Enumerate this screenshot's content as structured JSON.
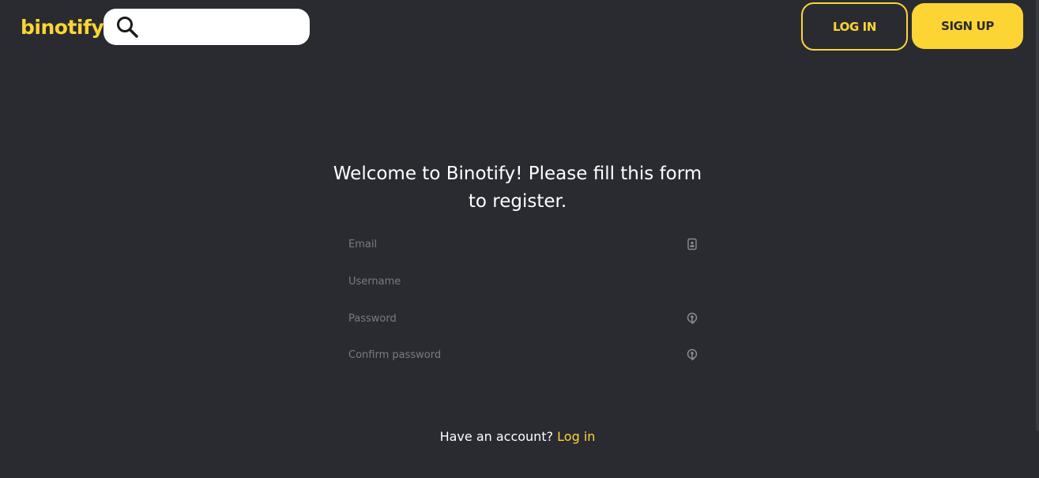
{
  "brand": {
    "name": "binotify",
    "accent_color": "#fcd535",
    "background_color": "#2a2b31"
  },
  "header": {
    "search": {
      "icon": "search-icon",
      "placeholder": ""
    },
    "login_label": "LOG IN",
    "signup_label": "SIGN UP"
  },
  "register_form": {
    "title": "Welcome to Binotify! Please fill this form to register.",
    "fields": {
      "email": {
        "placeholder": "Email",
        "icon": "id-card-icon"
      },
      "username": {
        "placeholder": "Username"
      },
      "password": {
        "placeholder": "Password",
        "icon": "key-icon"
      },
      "confirm_password": {
        "placeholder": "Confirm password",
        "icon": "key-icon"
      }
    }
  },
  "footer": {
    "prompt": "Have an account? ",
    "login_link": "Log in"
  }
}
